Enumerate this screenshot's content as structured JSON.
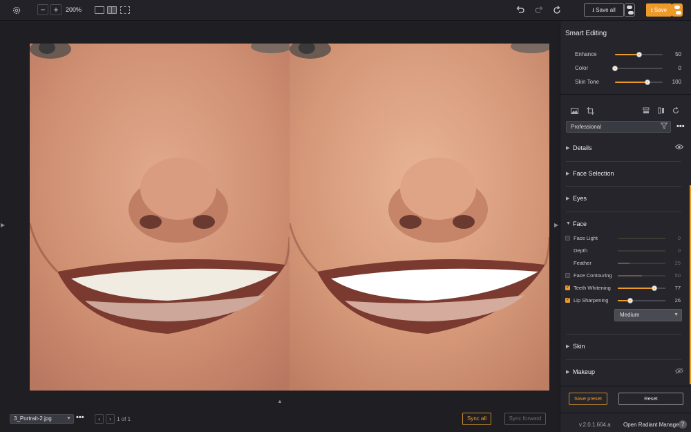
{
  "toolbar": {
    "settings_icon": "gear-icon",
    "zoom_out": "−",
    "zoom_in": "+",
    "zoom_level": "200%",
    "undo_icon": "undo-icon",
    "redo_icon": "redo-icon",
    "refresh_icon": "refresh-icon",
    "save_all_label": "Save all",
    "save_label": "Save"
  },
  "canvas": {
    "left_arrow": "▶",
    "right_arrow": "▶",
    "bottom_arrow": "▲"
  },
  "bottombar": {
    "file_name": "3_Portrait-2.jpg",
    "more": "•••",
    "prev": "‹",
    "next": "›",
    "page_count": "1 of 1",
    "sync_all_label": "Sync all",
    "sync_forward_label": "Sync forward"
  },
  "panel": {
    "title": "Smart Editing",
    "smart_sliders": [
      {
        "label": "Enhance",
        "value": "50"
      },
      {
        "label": "Color",
        "value": "0"
      },
      {
        "label": "Skin Tone",
        "value": "100"
      }
    ],
    "preset": "Professional",
    "preset_more": "•••",
    "sections": {
      "details": "Details",
      "face_selection": "Face Selection",
      "eyes": "Eyes",
      "face": "Face",
      "skin": "Skin",
      "makeup": "Makeup"
    },
    "face_rows": [
      {
        "label": "Face Light",
        "value": "0",
        "checked": false
      },
      {
        "label": "Depth",
        "value": "0",
        "checked": false
      },
      {
        "label": "Feather",
        "value": "25",
        "checked": false
      },
      {
        "label": "Face Contouring",
        "value": "50",
        "checked": false
      },
      {
        "label": "Teeth Whitening",
        "value": "77",
        "checked": true
      },
      {
        "label": "Lip Sharpening",
        "value": "26",
        "checked": true
      }
    ],
    "lip_mode": "Medium",
    "save_preset_label": "Save preset",
    "reset_label": "Reset",
    "version": "v.2.0.1.604.a",
    "manager_label": "Open Radiant Manager",
    "help": "?"
  }
}
